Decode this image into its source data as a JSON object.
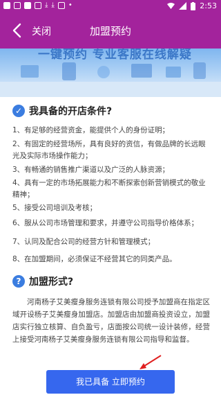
{
  "status": {
    "time": "2:53"
  },
  "header": {
    "close_label": "关闭",
    "title": "加盟预约"
  },
  "banner": {
    "text": "一键预约  专业客服在线解疑"
  },
  "conditions": {
    "title": "我具备的开店条件?",
    "items": [
      "1、有足够的经营资金，能提供个人的身份证明；",
      "2、有固定的经营场所，具有良好的资信，有做品牌的长远眼光及实际市场操作能力；",
      "3、有畅通的销售推广渠道以及广泛的人脉资源；",
      "4、具有一定的市场拓展能力和不断探索创新营销模式的敬业精神；",
      "5、接受公司培训及考核；",
      "6、服从公司市场管理和要求，并遵守公司指导价格体系；",
      "7、认同及配合公司的经营方针和管理模式；",
      "8、在加盟期间，必须保证不经营其它的同类产品。"
    ]
  },
  "join_form": {
    "title": "加盟形式?",
    "text": "河南杨子艾美瘦身服务连锁有限公司授予加盟商在指定区域开设杨子艾美瘦身加盟店。加盟店由加盟商投资设立，加盟店实行独立核算、自负盈亏，店面按公司统一设计装修，经营上接受河南杨子艾美瘦身服务连锁有限公司指导和监督。"
  },
  "cta": {
    "label": "我已具备 立即预约"
  },
  "colors": {
    "appbar": "#a3239c",
    "button": "#3667ee",
    "icon": "#3b7de0"
  }
}
